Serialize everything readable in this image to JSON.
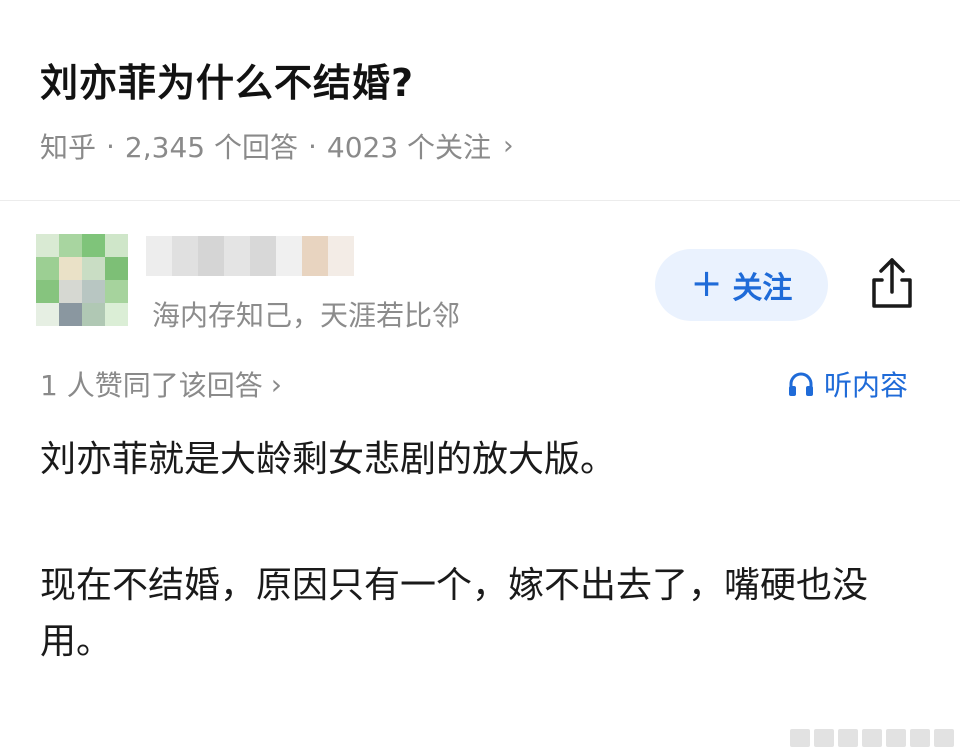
{
  "question": {
    "title": "刘亦菲为什么不结婚?",
    "source": "知乎",
    "answers_count": "2,345 个回答",
    "followers_count": "4023 个关注",
    "separator": "·",
    "chevron": "›"
  },
  "author": {
    "bio": "海内存知己，天涯若比邻",
    "follow_label": "关注",
    "follow_icon": "plus-icon",
    "share_icon": "share-icon"
  },
  "answer": {
    "likes_text": "1 人赞同了该回答",
    "likes_chevron": "›",
    "listen_label": "听内容",
    "listen_icon": "headphones-icon",
    "paragraph1": "刘亦菲就是大龄剩女悲剧的放大版。",
    "paragraph2": "现在不结婚，原因只有一个，嫁不出去了，嘴硬也没用。"
  },
  "colors": {
    "accent": "#1f6bd8",
    "accent_bg": "#eaf2fe",
    "muted_text": "#8a8a8a"
  }
}
